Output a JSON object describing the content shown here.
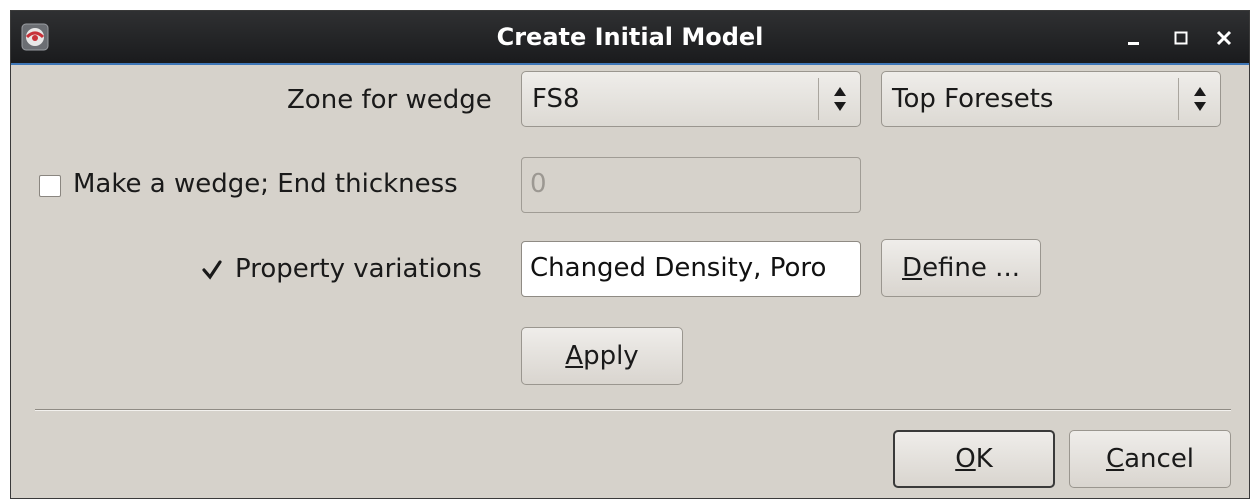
{
  "window": {
    "title": "Create Initial Model",
    "controls": {
      "minimize": "_",
      "maximize": "□",
      "close": "✕"
    }
  },
  "form": {
    "zone_label": "Zone for wedge",
    "zone_value": "FS8",
    "foresets_value": "Top Foresets",
    "wedge_label": "Make a wedge; End thickness",
    "wedge_checked": false,
    "wedge_thickness_value": "0",
    "property_label": "Property variations",
    "property_checked": true,
    "property_value": "Changed Density, Poro",
    "define_button": {
      "mnemonic": "D",
      "rest": "efine ..."
    },
    "apply_button": {
      "mnemonic": "A",
      "rest": "pply"
    }
  },
  "footer": {
    "ok_button": {
      "mnemonic": "O",
      "rest": "K"
    },
    "cancel_button": {
      "mnemonic": "C",
      "rest": "ancel"
    }
  },
  "icons": {
    "app": "app-logo-icon",
    "combo_arrows": "up-down-arrows-icon",
    "check": "checkmark-icon"
  }
}
